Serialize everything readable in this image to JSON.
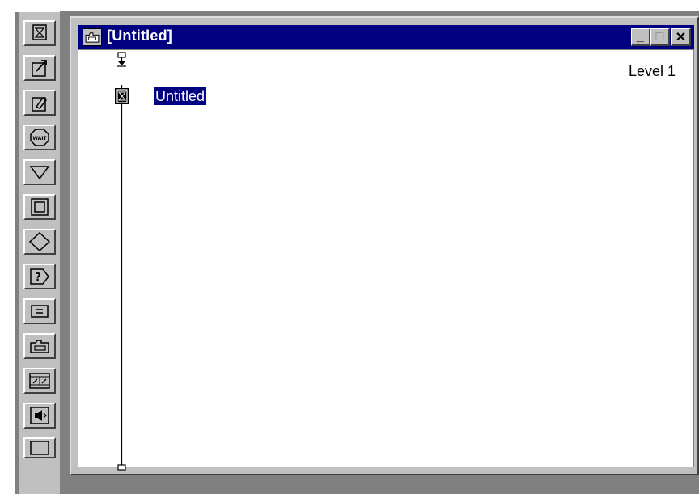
{
  "window": {
    "title": "[Untitled]",
    "controls": {
      "minimize": "_",
      "maximize": "□",
      "close": "✕"
    }
  },
  "flowline": {
    "level_label": "Level 1",
    "icons": [
      {
        "label": "Untitled",
        "icon": "display-icon",
        "selected": true
      }
    ]
  },
  "palette": {
    "tools": [
      "display-icon",
      "animation-icon",
      "erase-icon",
      "wait-icon",
      "navigation-icon",
      "framework-icon",
      "decision-icon",
      "interaction-icon",
      "calculation-icon",
      "map-icon",
      "digital-movie-icon",
      "sound-icon",
      "video-icon"
    ]
  },
  "colors": {
    "titlebar": "#000080",
    "chrome": "#c0c0c0",
    "mdi_background": "#808080",
    "selection": "#000080"
  }
}
